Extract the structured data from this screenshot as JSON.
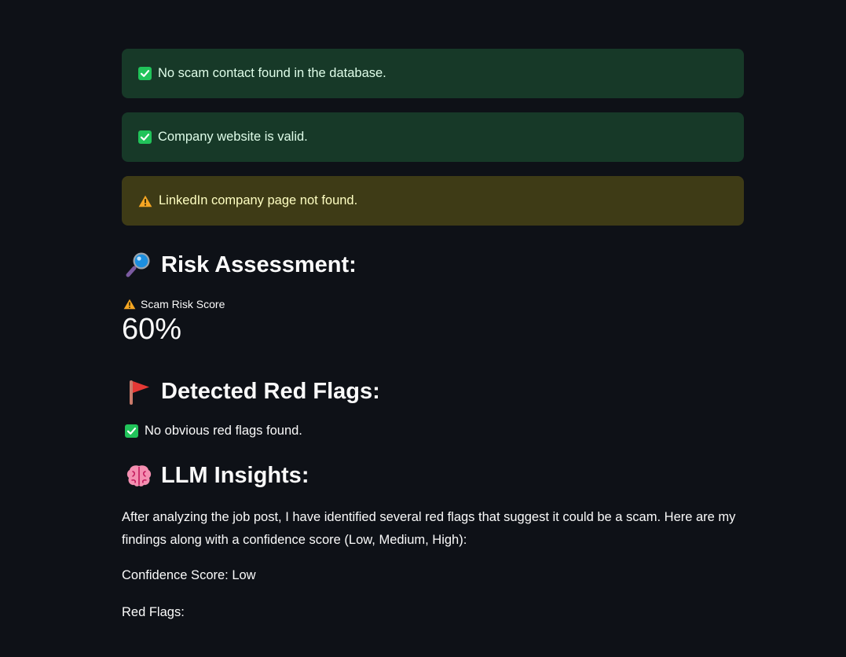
{
  "alerts": [
    {
      "type": "success",
      "icon": "check-box-icon",
      "text": "No scam contact found in the database."
    },
    {
      "type": "success",
      "icon": "check-box-icon",
      "text": "Company website is valid."
    },
    {
      "type": "warning",
      "icon": "warning-icon",
      "text": "LinkedIn company page not found."
    }
  ],
  "risk": {
    "heading": "Risk Assessment:",
    "emoji": "magnifying-glass-icon",
    "metric_label": "Scam Risk Score",
    "metric_value": "60%"
  },
  "flags": {
    "heading": "Detected Red Flags:",
    "emoji": "red-flag-icon",
    "none_text": "No obvious red flags found."
  },
  "llm": {
    "heading": "LLM Insights:",
    "emoji": "brain-icon",
    "intro": "After analyzing the job post, I have identified several red flags that suggest it could be a scam. Here are my findings along with a confidence score (Low, Medium, High):",
    "confidence": "Confidence Score: Low",
    "red_flags_label": "Red Flags:"
  },
  "colors": {
    "background": "#0e1117",
    "success_bg": "#173928",
    "success_text": "#dffde9",
    "warning_bg": "#3e3b16",
    "warning_text": "#ffffc2",
    "check_green": "#21c35a",
    "warning_orange": "#f5a623"
  }
}
